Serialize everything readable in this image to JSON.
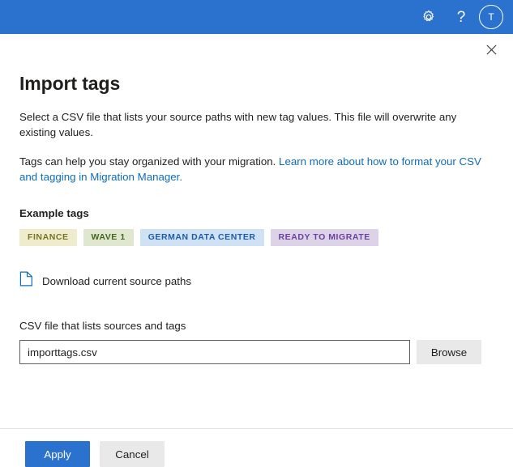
{
  "suite_bar": {
    "background": "#2a72cd",
    "settings_icon": "gear-icon",
    "help_label": "?",
    "avatar_initial": "T"
  },
  "panel": {
    "close_icon": "close-icon",
    "title": "Import tags",
    "description_1": "Select a CSV file that lists your source paths with new tag values. This file will overwrite any existing values.",
    "description_2_prefix": "Tags can help you stay organized with your migration. ",
    "description_2_link": "Learn more about how to format your CSV and tagging in Migration Manager.",
    "example_tags_heading": "Example tags",
    "tags": [
      {
        "label": "FINANCE",
        "background": "#efeccd",
        "color": "#7a7320"
      },
      {
        "label": "WAVE 1",
        "background": "#dfe8cf",
        "color": "#44661f"
      },
      {
        "label": "GERMAN DATA CENTER",
        "background": "#cfe1f5",
        "color": "#1f5ca8"
      },
      {
        "label": "READY TO MIGRATE",
        "background": "#ddd3e8",
        "color": "#6b3f9e"
      }
    ],
    "download_icon": "file-document-icon",
    "download_label": "Download current source paths",
    "file_field_label": "CSV file that lists sources and tags",
    "file_field_value": "importtags.csv",
    "file_field_placeholder": "",
    "browse_label": "Browse"
  },
  "footer": {
    "apply_label": "Apply",
    "cancel_label": "Cancel"
  }
}
